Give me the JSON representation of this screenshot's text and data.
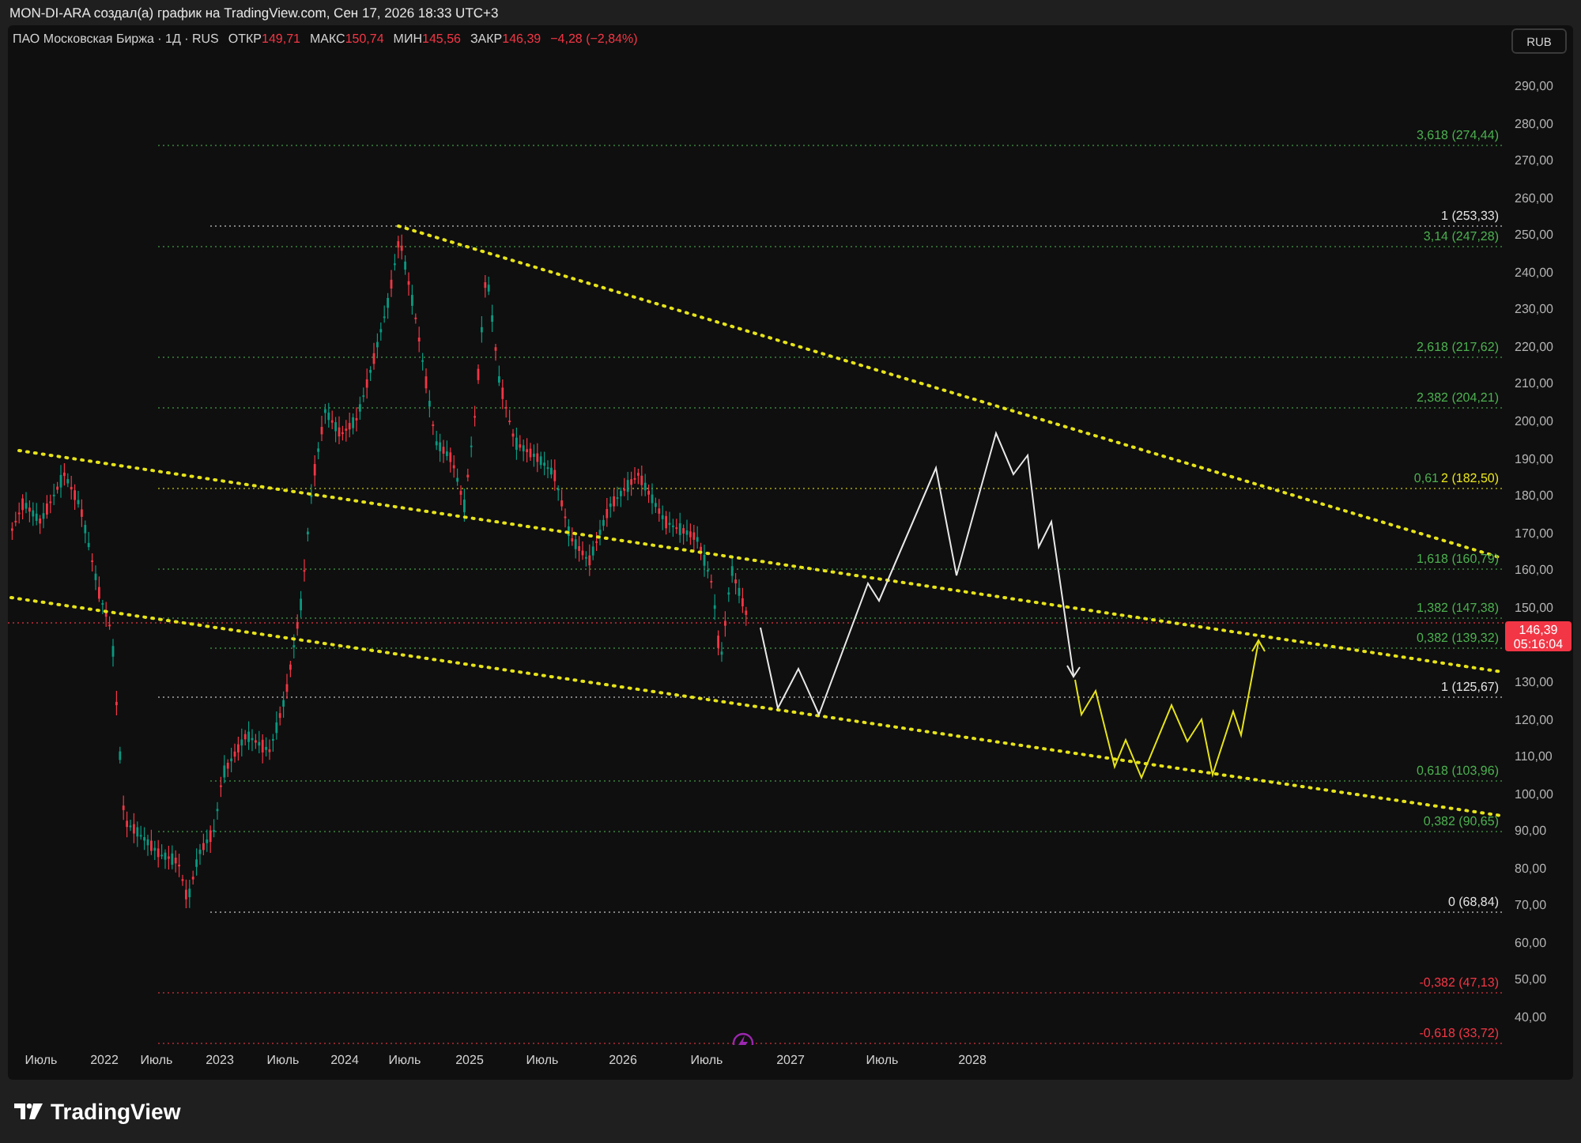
{
  "header": {
    "title": "MON-DI-ARA создал(а) график на TradingView.com, Сен 17, 2026 18:33 UTC+3"
  },
  "legend": {
    "symbol": "ПАО Московская Биржа · 1Д · RUS",
    "fields": [
      {
        "label": "ОТКР",
        "value": "149,71"
      },
      {
        "label": "МАКС",
        "value": "150,74"
      },
      {
        "label": "МИН",
        "value": "145,56"
      },
      {
        "label": "ЗАКР",
        "value": "146,39"
      }
    ],
    "change": "−4,28 (−2,84%)"
  },
  "currency_button": "RUB",
  "price_axis": [
    "290,00",
    "280,00",
    "270,00",
    "260,00",
    "250,00",
    "240,00",
    "230,00",
    "220,00",
    "210,00",
    "200,00",
    "190,00",
    "180,00",
    "170,00",
    "160,00",
    "150,00",
    "130,00",
    "120,00",
    "110,00",
    "100,00",
    "90,00",
    "80,00",
    "70,00",
    "60,00",
    "50,00",
    "40,00"
  ],
  "fib_levels": [
    {
      "label": "3,618 (274,44)",
      "color": "#4caf50"
    },
    {
      "label": "1 (253,33)",
      "color": "#e0e0e0"
    },
    {
      "label": "3,14 (247,28)",
      "color": "#4caf50"
    },
    {
      "label": "2,618 (217,62)",
      "color": "#4caf50"
    },
    {
      "label": "2,382 (204,21)",
      "color": "#4caf50"
    },
    {
      "label": "0,61",
      "color": "#4caf50"
    },
    {
      "label": "2 (182,50)",
      "color": "#e6e31a"
    },
    {
      "label": "1,618 (160,79)",
      "color": "#4caf50"
    },
    {
      "label": "1,382 (147,38)",
      "color": "#4caf50"
    },
    {
      "label": "0,382 (139,32)",
      "color": "#4caf50"
    },
    {
      "label": "1 (125,67)",
      "color": "#e0e0e0"
    },
    {
      "label": "0,618 (103,96)",
      "color": "#4caf50"
    },
    {
      "label": "0,382 (90,65)",
      "color": "#4caf50"
    },
    {
      "label": "0 (68,84)",
      "color": "#e0e0e0"
    },
    {
      "label": "-0,382 (47,13)",
      "color": "#f23645"
    },
    {
      "label": "-0,618 (33,72)",
      "color": "#f23645"
    }
  ],
  "price_badge": {
    "price": "146,39",
    "countdown": "05:16:04"
  },
  "time_axis": [
    "Июль",
    "2022",
    "Июль",
    "2023",
    "Июль",
    "2024",
    "Июль",
    "2025",
    "Июль",
    "2026",
    "Июль",
    "2027",
    "Июль",
    "2028"
  ],
  "footer": {
    "brand": "TradingView"
  }
}
